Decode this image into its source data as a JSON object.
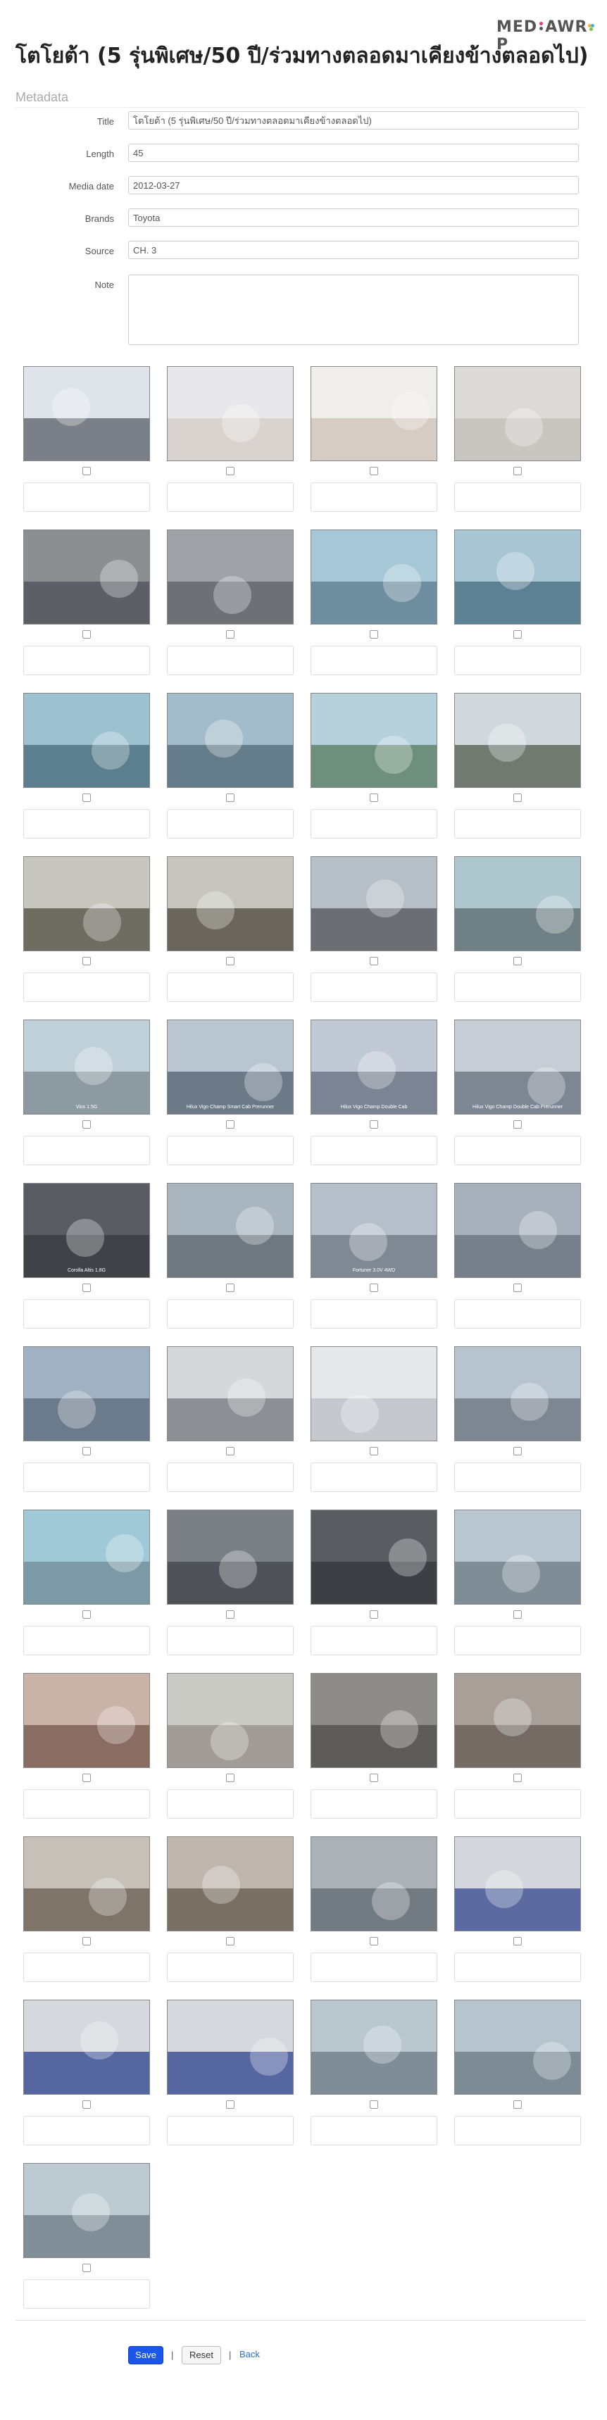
{
  "logo": {
    "text_a": "MED",
    "text_b": "A",
    "text_c": "WR",
    "text_d": "P"
  },
  "title": "โตโยต้า (5 รุ่นพิเศษ/50 ปี/ร่วมทางตลอดมาเคียงข้างตลอดไป)",
  "metadata_label": "Metadata",
  "fields": [
    {
      "label": "Title",
      "value": "โตโยต้า (5 รุ่นพิเศษ/50 ปี/ร่วมทางตลอดมาเคียงข้างตลอดไป)"
    },
    {
      "label": "Length",
      "value": "45"
    },
    {
      "label": "Media date",
      "value": "2012-03-27"
    },
    {
      "label": "Brands",
      "value": "Toyota"
    },
    {
      "label": "Source",
      "value": "CH. 3"
    },
    {
      "label": "Note",
      "value": ""
    }
  ],
  "thumbnails": [
    {
      "sky": "#dfe4ea",
      "ground": "#7b8088",
      "cap": ""
    },
    {
      "sky": "#e8e8ea",
      "ground": "#d9d3cf",
      "cap": ""
    },
    {
      "sky": "#efeeea",
      "ground": "#d7ccc4",
      "cap": ""
    },
    {
      "sky": "#dcdad6",
      "ground": "#c9c6c1",
      "cap": ""
    },
    {
      "sky": "#8c8f92",
      "ground": "#5c6066",
      "cap": ""
    },
    {
      "sky": "#9fa2a6",
      "ground": "#6d7177",
      "cap": ""
    },
    {
      "sky": "#a6c8d6",
      "ground": "#6e8ea0",
      "cap": ""
    },
    {
      "sky": "#a7c5d3",
      "ground": "#5c8195",
      "cap": ""
    },
    {
      "sky": "#9cc2d0",
      "ground": "#5b7f8e",
      "cap": ""
    },
    {
      "sky": "#a3bccb",
      "ground": "#657c8a",
      "cap": ""
    },
    {
      "sky": "#b7d1dc",
      "ground": "#6d8f7b",
      "cap": ""
    },
    {
      "sky": "#d2d9dc",
      "ground": "#707a70",
      "cap": ""
    },
    {
      "sky": "#c7c7c0",
      "ground": "#6f6c61",
      "cap": ""
    },
    {
      "sky": "#c6c6bf",
      "ground": "#6a665b",
      "cap": ""
    },
    {
      "sky": "#b6bfc6",
      "ground": "#6b6f75",
      "cap": ""
    },
    {
      "sky": "#aec7cf",
      "ground": "#6f8184",
      "cap": ""
    },
    {
      "sky": "#bfd0d8",
      "ground": "#8e9aa2",
      "cap": "Vios 1.5G"
    },
    {
      "sky": "#b9c6d2",
      "ground": "#6c7a88",
      "cap": "Hilux Vigo Champ Smart Cab Prerunner"
    },
    {
      "sky": "#c2c9d6",
      "ground": "#7b8492",
      "cap": "Hilux Vigo Champ Double Cab"
    },
    {
      "sky": "#c7cdd5",
      "ground": "#7d8693",
      "cap": "Hilux Vigo Champ Double Cab Prerunner"
    },
    {
      "sky": "#595d63",
      "ground": "#3f4247",
      "cap": "Corolla Altis 1.8G"
    },
    {
      "sky": "#a9b6bf",
      "ground": "#6e7880",
      "cap": ""
    },
    {
      "sky": "#b5bfc9",
      "ground": "#7f8994",
      "cap": "Fortuner 3.0V 4WD"
    },
    {
      "sky": "#a7b1bb",
      "ground": "#75808a",
      "cap": ""
    },
    {
      "sky": "#9fb1c2",
      "ground": "#6b7b8c",
      "cap": ""
    },
    {
      "sky": "#d5d8db",
      "ground": "#8c8f93",
      "cap": ""
    },
    {
      "sky": "#e6e7ea",
      "ground": "#c5c9cf",
      "cap": ""
    },
    {
      "sky": "#b7c4cf",
      "ground": "#7d8792",
      "cap": ""
    },
    {
      "sky": "#9fc9d6",
      "ground": "#7c9aa6",
      "cap": ""
    },
    {
      "sky": "#7b7f86",
      "ground": "#4f5359",
      "cap": ""
    },
    {
      "sky": "#595c61",
      "ground": "#3c3f44",
      "cap": ""
    },
    {
      "sky": "#b8c6cf",
      "ground": "#7f8d96",
      "cap": ""
    },
    {
      "sky": "#c9b2a8",
      "ground": "#8a6d62",
      "cap": ""
    },
    {
      "sky": "#cbcbc6",
      "ground": "#a19d96",
      "cap": ""
    },
    {
      "sky": "#8d8c88",
      "ground": "#5e5c58",
      "cap": ""
    },
    {
      "sky": "#a79f98",
      "ground": "#736b64",
      "cap": ""
    },
    {
      "sky": "#c7c0b8",
      "ground": "#7e7468",
      "cap": ""
    },
    {
      "sky": "#bfb6ad",
      "ground": "#7a6f63",
      "cap": ""
    },
    {
      "sky": "#aab2b8",
      "ground": "#737b82",
      "cap": ""
    },
    {
      "sky": "#d3d6dc",
      "ground": "#5b6aa0",
      "cap": ""
    },
    {
      "sky": "#d6d8dd",
      "ground": "#5566a0",
      "cap": ""
    },
    {
      "sky": "#d6d8dd",
      "ground": "#5566a0",
      "cap": ""
    },
    {
      "sky": "#b9c7cf",
      "ground": "#7f8d96",
      "cap": ""
    },
    {
      "sky": "#b6c5cd",
      "ground": "#7d8b94",
      "cap": ""
    },
    {
      "sky": "#bccad2",
      "ground": "#7f8e97",
      "cap": ""
    }
  ],
  "buttons": {
    "save": "Save",
    "separator": "|",
    "reset": "Reset",
    "back": "Back"
  }
}
